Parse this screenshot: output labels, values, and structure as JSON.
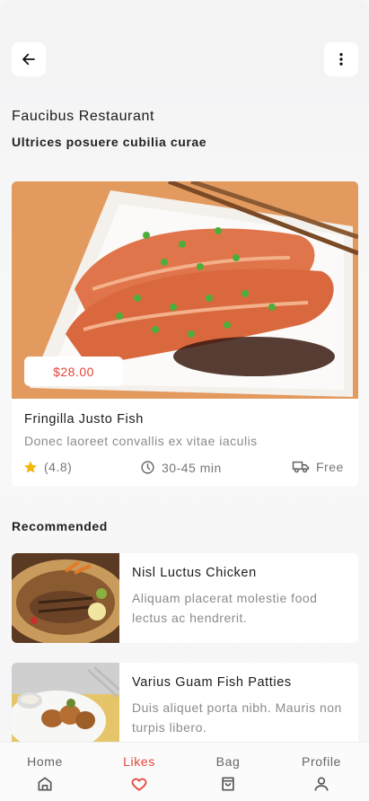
{
  "header": {
    "restaurant_name": "Faucibus Restaurant",
    "restaurant_subtitle": "Ultrices posuere cubilia curae"
  },
  "featured": {
    "price": "$28.00",
    "title": "Fringilla Justo Fish",
    "description": "Donec laoreet convallis ex vitae iaculis",
    "rating": "(4.8)",
    "time": "30-45 min",
    "delivery": "Free"
  },
  "recommended": {
    "title": "Recommended",
    "items": [
      {
        "title": "Nisl Luctus Chicken",
        "description": "Aliquam placerat molestie food lectus ac hendrerit."
      },
      {
        "title": "Varius Guam Fish Patties",
        "description": "Duis aliquet porta nibh. Mauris non turpis libero."
      }
    ]
  },
  "nav": {
    "items": [
      {
        "label": "Home",
        "icon": "home-icon"
      },
      {
        "label": "Likes",
        "icon": "heart-icon"
      },
      {
        "label": "Bag",
        "icon": "bag-icon"
      },
      {
        "label": "Profile",
        "icon": "profile-icon"
      }
    ],
    "active": "Likes"
  },
  "colors": {
    "accent": "#e4453a",
    "star": "#f5b400"
  }
}
